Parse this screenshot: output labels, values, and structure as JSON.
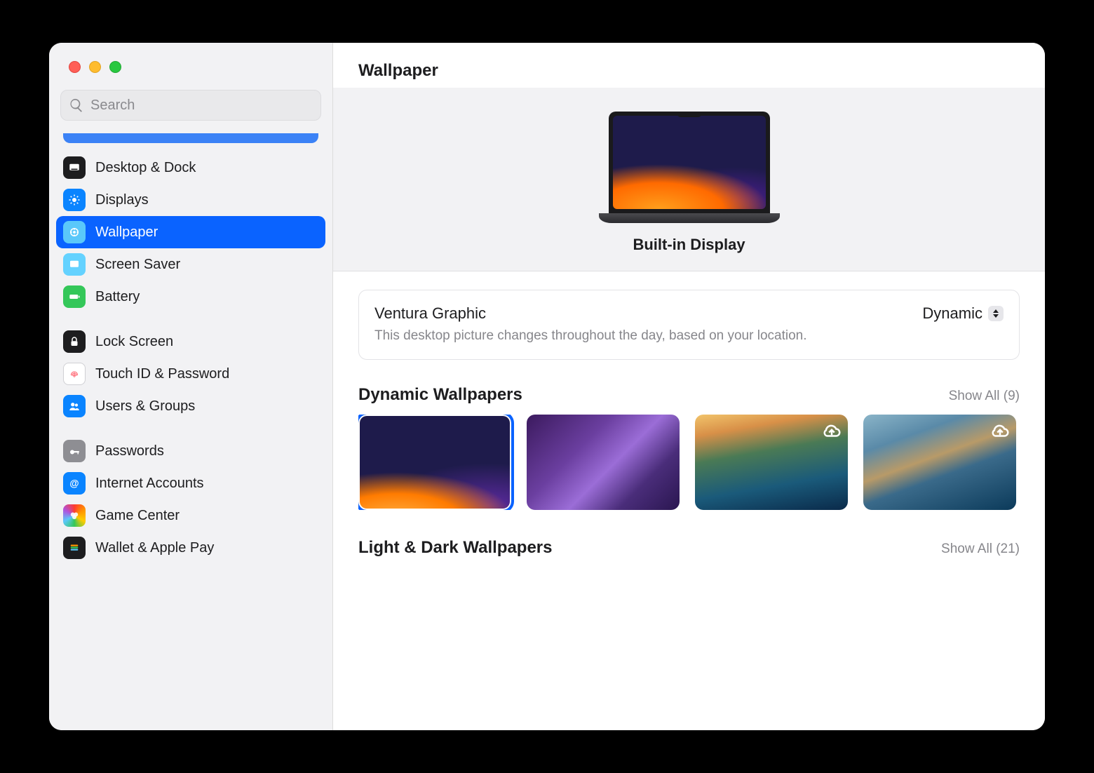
{
  "header": {
    "title": "Wallpaper"
  },
  "search": {
    "placeholder": "Search"
  },
  "sidebar": {
    "groups": [
      {
        "items": [
          {
            "label": "Desktop & Dock",
            "icon": "desktop-dock-icon",
            "bg": "bg-black"
          },
          {
            "label": "Displays",
            "icon": "displays-icon",
            "bg": "bg-blue"
          },
          {
            "label": "Wallpaper",
            "icon": "wallpaper-icon",
            "bg": "bg-teal",
            "selected": true
          },
          {
            "label": "Screen Saver",
            "icon": "screensaver-icon",
            "bg": "bg-cyan"
          },
          {
            "label": "Battery",
            "icon": "battery-icon",
            "bg": "bg-green"
          }
        ]
      },
      {
        "items": [
          {
            "label": "Lock Screen",
            "icon": "lock-icon",
            "bg": "bg-black"
          },
          {
            "label": "Touch ID & Password",
            "icon": "touchid-icon",
            "bg": "bg-white",
            "fg": "#ff7a85"
          },
          {
            "label": "Users & Groups",
            "icon": "users-icon",
            "bg": "bg-blue"
          }
        ]
      },
      {
        "items": [
          {
            "label": "Passwords",
            "icon": "key-icon",
            "bg": "bg-gray"
          },
          {
            "label": "Internet Accounts",
            "icon": "at-icon",
            "bg": "bg-blue"
          },
          {
            "label": "Game Center",
            "icon": "gamecenter-icon",
            "bg": "bg-rainbow"
          },
          {
            "label": "Wallet & Apple Pay",
            "icon": "wallet-icon",
            "bg": "bg-black"
          }
        ]
      }
    ]
  },
  "preview": {
    "display_name": "Built-in Display"
  },
  "current": {
    "name": "Ventura Graphic",
    "description": "This desktop picture changes throughout the day, based on your location.",
    "mode": "Dynamic"
  },
  "sections": [
    {
      "title": "Dynamic Wallpapers",
      "show_all_label": "Show All",
      "count": 9,
      "thumbs": [
        {
          "cls": "wp-ventura",
          "selected": true,
          "download": false
        },
        {
          "cls": "wp-monterey",
          "selected": false,
          "download": false
        },
        {
          "cls": "wp-bigsur",
          "selected": false,
          "download": true
        },
        {
          "cls": "wp-catalina",
          "selected": false,
          "download": true
        },
        {
          "cls": "wp-dark",
          "selected": false,
          "download": false
        }
      ]
    },
    {
      "title": "Light & Dark Wallpapers",
      "show_all_label": "Show All",
      "count": 21,
      "thumbs": []
    }
  ]
}
